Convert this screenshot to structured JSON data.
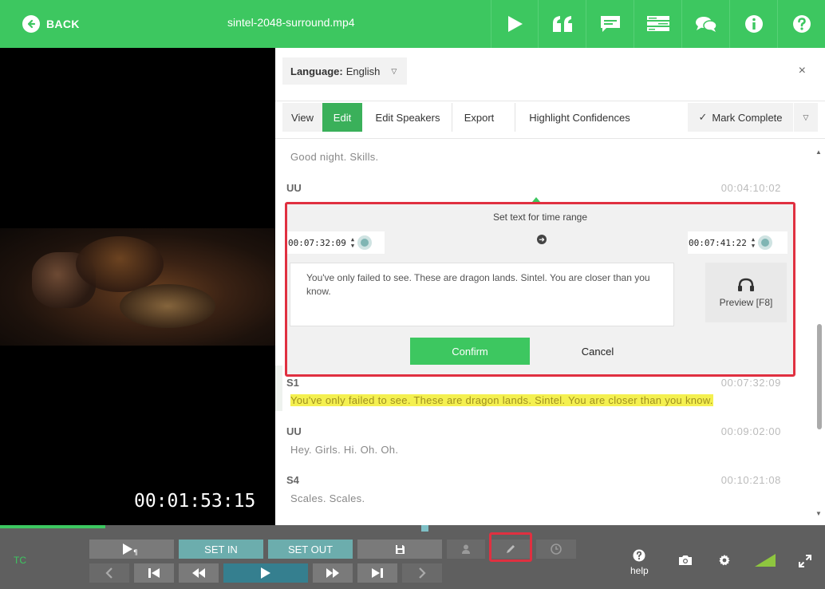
{
  "header": {
    "back_label": "BACK",
    "file_title": "sintel-2048-surround.mp4",
    "icons": [
      "play-icon",
      "quote-icon",
      "caption-icon",
      "list-icon",
      "chat-icon",
      "info-icon",
      "help-icon"
    ]
  },
  "video": {
    "timecode": "00:01:53:15"
  },
  "panel": {
    "language_label": "Language:",
    "language_value": "English",
    "close_symbol": "×",
    "tabs": {
      "view": "View",
      "edit": "Edit",
      "edit_speakers": "Edit Speakers",
      "export": "Export",
      "highlight": "Highlight Confidences"
    },
    "mark_complete": "Mark Complete"
  },
  "transcript": {
    "top_text": "Good night. Skills.",
    "segments": [
      {
        "speaker": "UU",
        "time": "00:04:10:02"
      },
      {
        "speaker": "S1",
        "time": "00:07:32:09",
        "text": "You've only failed to see. These are dragon lands. Sintel. You are closer than you know."
      },
      {
        "speaker": "UU",
        "time": "00:09:02:00",
        "text": "Hey. Girls. Hi. Oh. Oh."
      },
      {
        "speaker": "S4",
        "time": "00:10:21:08",
        "text": "Scales. Scales."
      }
    ]
  },
  "dialog": {
    "title": "Set text for time range",
    "start_time": "00:07:32:09",
    "end_time": "00:07:41:22",
    "text": "You've only failed to see. These are dragon lands. Sintel. You are closer than you know.",
    "preview_label": "Preview [F8]",
    "confirm_label": "Confirm",
    "cancel_label": "Cancel"
  },
  "controls": {
    "tc_label": "TC",
    "set_in": "SET IN",
    "set_out": "SET OUT",
    "help_label": "help"
  },
  "colors": {
    "brand_green": "#3dc760",
    "highlight_red": "#e03040",
    "teal": "#6cadad"
  }
}
